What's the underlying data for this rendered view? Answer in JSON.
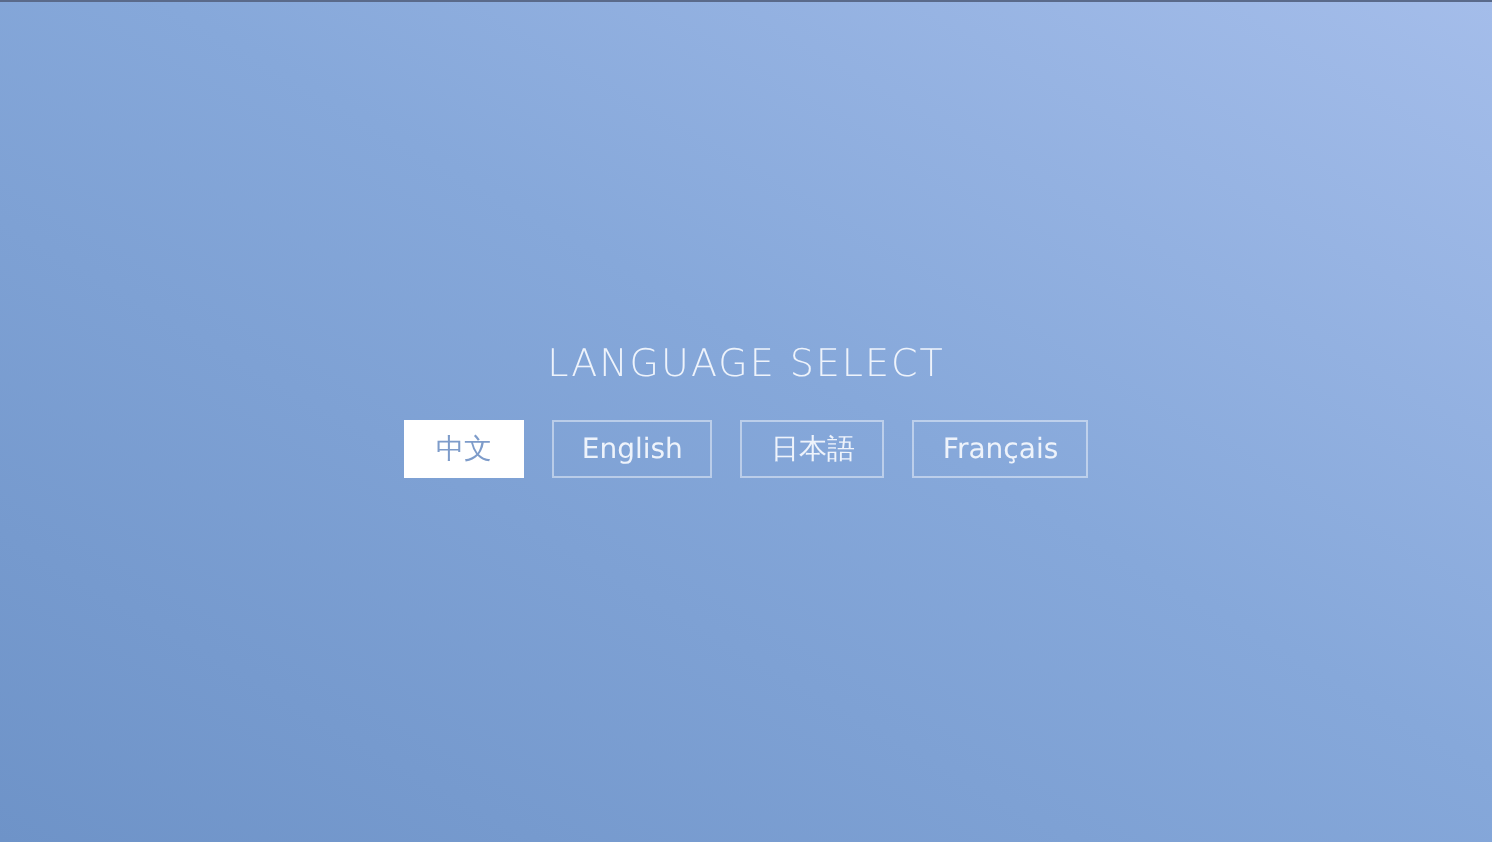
{
  "title": "LANGUAGE SELECT",
  "languages": [
    {
      "label": "中文",
      "selected": true
    },
    {
      "label": "English",
      "selected": false
    },
    {
      "label": "日本語",
      "selected": false
    },
    {
      "label": "Français",
      "selected": false
    }
  ]
}
